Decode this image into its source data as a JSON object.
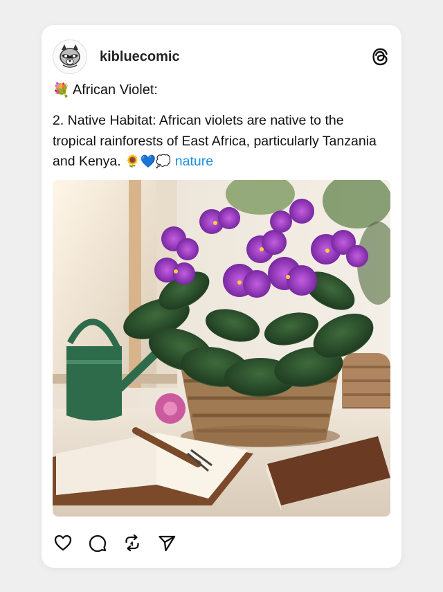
{
  "post": {
    "username": "kibluecomic",
    "title_emoji": "💐",
    "title": "African Violet:",
    "body_text": "2. Native Habitat: African violets are native to the tropical rainforests of East Africa, particularly Tanzania and Kenya.",
    "body_emojis": "🌻💙💭",
    "hashtag": "nature",
    "image_alt": "African violet plant in a wicker basket by a window with a green watering can and open book",
    "icons": {
      "avatar": "raccoon-avatar-icon",
      "logo": "threads-logo-icon",
      "like": "heart-icon",
      "comment": "comment-icon",
      "repost": "repost-icon",
      "share": "send-icon"
    }
  },
  "colors": {
    "background": "#efefef",
    "card": "#ffffff",
    "hashtag": "#1d8fe0",
    "violet": "#8a2bb8"
  }
}
